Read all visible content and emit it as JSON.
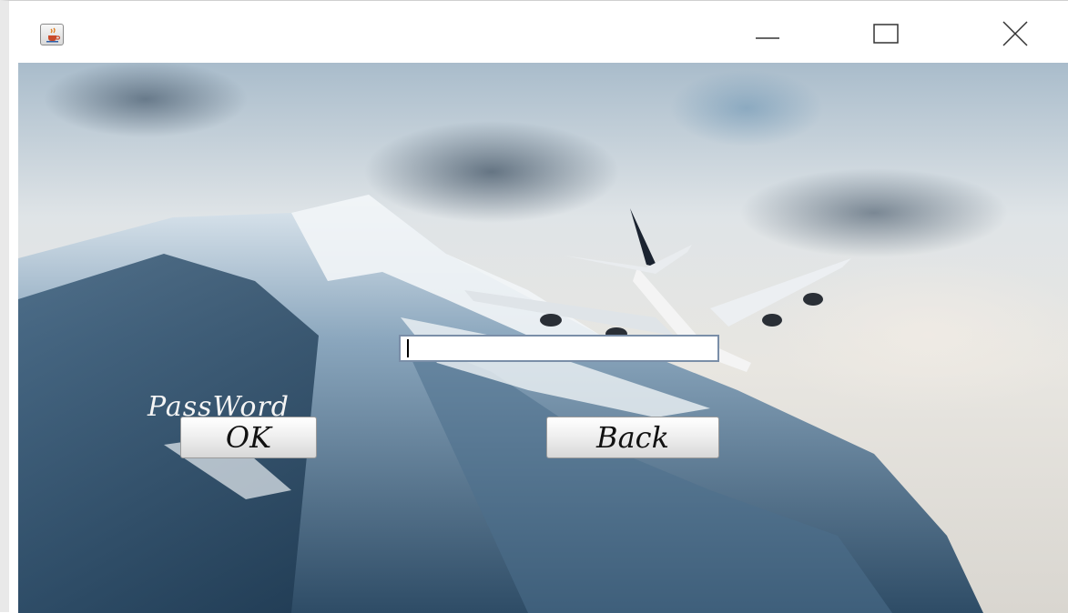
{
  "window": {
    "icon": "java-cup-icon",
    "controls": {
      "minimize": "minimize-icon",
      "maximize": "maximize-icon",
      "close": "close-icon"
    }
  },
  "form": {
    "password_label": "PassWord",
    "password_value": "",
    "ok_label": "OK",
    "back_label": "Back"
  },
  "colors": {
    "label_text": "#f4f4f4",
    "button_text": "#111111",
    "input_border": "#7a8ea8"
  },
  "background": {
    "description_icon": "mountain-airplane-wallpaper"
  }
}
